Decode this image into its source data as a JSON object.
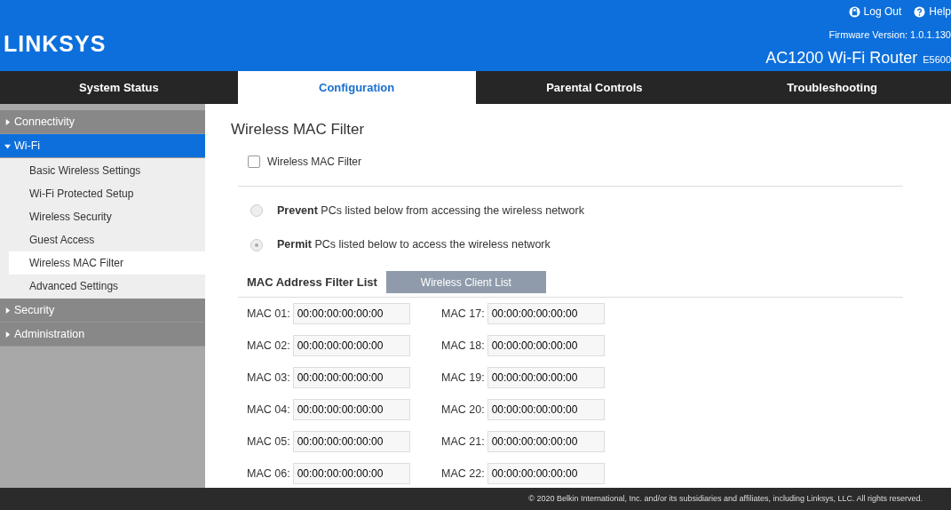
{
  "header": {
    "logo": "LINKSYS",
    "links": [
      {
        "kind": "logout",
        "label": "Log Out"
      },
      {
        "kind": "help",
        "label": "Help"
      }
    ],
    "firmware": "Firmware Version: 1.0.1.130",
    "product": "AC1200 Wi-Fi Router",
    "model": "E5600"
  },
  "tabs": [
    {
      "label": "System Status",
      "selected": false
    },
    {
      "label": "Configuration",
      "selected": true
    },
    {
      "label": "Parental Controls",
      "selected": false
    },
    {
      "label": "Troubleshooting",
      "selected": false
    }
  ],
  "sidebar": {
    "sections": [
      {
        "label": "Connectivity",
        "expanded": false
      },
      {
        "label": "Wi-Fi",
        "expanded": true,
        "children": [
          {
            "label": "Basic Wireless Settings",
            "selected": false
          },
          {
            "label": "Wi-Fi Protected Setup",
            "selected": false
          },
          {
            "label": "Wireless Security",
            "selected": false
          },
          {
            "label": "Guest Access",
            "selected": false
          },
          {
            "label": "Wireless MAC Filter",
            "selected": true
          },
          {
            "label": "Advanced Settings",
            "selected": false
          }
        ]
      },
      {
        "label": "Security",
        "expanded": false
      },
      {
        "label": "Administration",
        "expanded": false
      }
    ]
  },
  "content": {
    "title": "Wireless MAC Filter",
    "enable": {
      "label": "Wireless MAC Filter",
      "checked": false
    },
    "options": [
      {
        "label": "**Prevent** PCs listed below from accessing the wireless network",
        "selected": false
      },
      {
        "label": "**Permit** PCs listed below to access the wireless network",
        "selected": true
      }
    ],
    "list_title": "MAC Address Filter List",
    "client_list_button": "Wireless Client List",
    "macs": [
      {
        "label": "MAC 01:",
        "value": "00:00:00:00:00:00"
      },
      {
        "label": "MAC 17:",
        "value": "00:00:00:00:00:00"
      },
      {
        "label": "MAC 02:",
        "value": "00:00:00:00:00:00"
      },
      {
        "label": "MAC 18:",
        "value": "00:00:00:00:00:00"
      },
      {
        "label": "MAC 03:",
        "value": "00:00:00:00:00:00"
      },
      {
        "label": "MAC 19:",
        "value": "00:00:00:00:00:00"
      },
      {
        "label": "MAC 04:",
        "value": "00:00:00:00:00:00"
      },
      {
        "label": "MAC 20:",
        "value": "00:00:00:00:00:00"
      },
      {
        "label": "MAC 05:",
        "value": "00:00:00:00:00:00"
      },
      {
        "label": "MAC 21:",
        "value": "00:00:00:00:00:00"
      },
      {
        "label": "MAC 06:",
        "value": "00:00:00:00:00:00"
      },
      {
        "label": "MAC 22:",
        "value": "00:00:00:00:00:00"
      }
    ]
  },
  "footer": "© 2020 Belkin International, Inc. and/or its subsidiaries and affiliates, including Linksys, LLC. All rights reserved."
}
